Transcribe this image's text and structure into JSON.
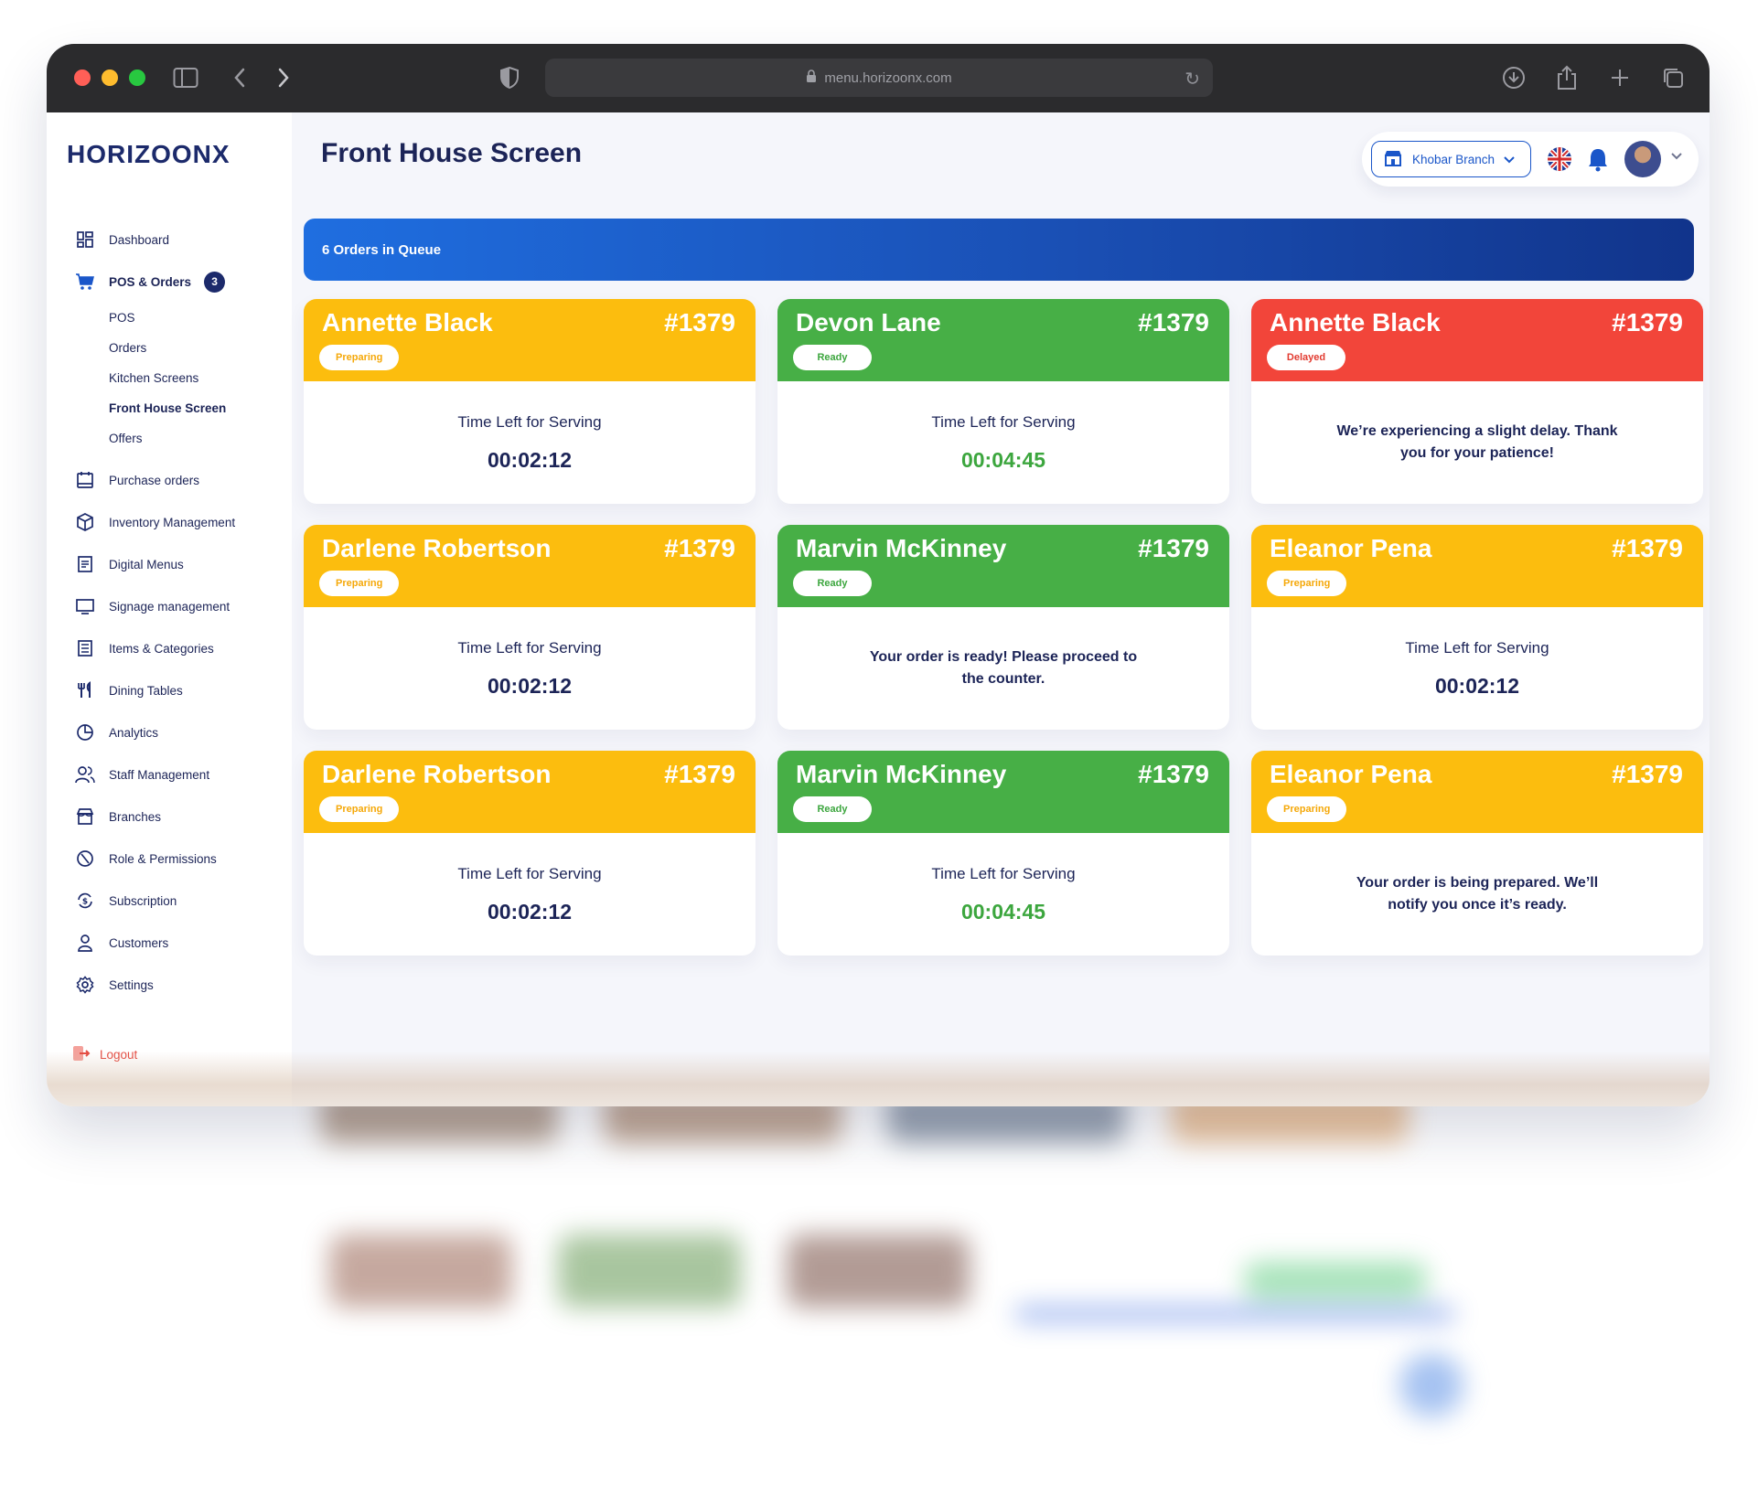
{
  "browser": {
    "url": "menu.horizoonx.com",
    "traffic_lights": [
      "#ff5f57",
      "#febc2e",
      "#28c840"
    ]
  },
  "app": {
    "logo": "HORIZOONX"
  },
  "sidebar": {
    "items": [
      {
        "id": "dashboard",
        "label": "Dashboard",
        "icon": "grid-icon"
      },
      {
        "id": "pos-orders",
        "label": "POS & Orders",
        "icon": "cart-icon",
        "badge": "3",
        "children": [
          "POS",
          "Orders",
          "Kitchen Screens",
          "Front House Screen",
          "Offers"
        ],
        "current_child": "Front House Screen"
      },
      {
        "id": "purchase-orders",
        "label": "Purchase orders",
        "icon": "clipboard-icon"
      },
      {
        "id": "inventory",
        "label": "Inventory Management",
        "icon": "box-icon"
      },
      {
        "id": "digital-menus",
        "label": "Digital Menus",
        "icon": "menu-doc-icon"
      },
      {
        "id": "signage",
        "label": "Signage management",
        "icon": "monitor-icon"
      },
      {
        "id": "items-categories",
        "label": "Items & Categories",
        "icon": "list-icon"
      },
      {
        "id": "dining-tables",
        "label": "Dining Tables",
        "icon": "fork-knife-icon"
      },
      {
        "id": "analytics",
        "label": "Analytics",
        "icon": "pie-chart-icon"
      },
      {
        "id": "staff",
        "label": "Staff Management",
        "icon": "users-icon"
      },
      {
        "id": "branches",
        "label": "Branches",
        "icon": "store-icon"
      },
      {
        "id": "roles",
        "label": "Role & Permissions",
        "icon": "shield-icon"
      },
      {
        "id": "subscription",
        "label": "Subscription",
        "icon": "refresh-coin-icon"
      },
      {
        "id": "customers",
        "label": "Customers",
        "icon": "user-icon"
      },
      {
        "id": "settings",
        "label": "Settings",
        "icon": "gear-icon"
      }
    ],
    "logout": "Logout"
  },
  "header": {
    "title": "Front House Screen",
    "branch": "Khobar Branch",
    "language_flag": "uk-flag-icon"
  },
  "queue": {
    "label": "6 Orders in Queue"
  },
  "orders": [
    {
      "name": "Annette Black",
      "number": "#1379",
      "status": "Preparing",
      "color": "#fcbd0e",
      "type": "timer",
      "label": "Time Left for Serving",
      "time": "00:02:12"
    },
    {
      "name": "Devon Lane",
      "number": "#1379",
      "status": "Ready",
      "color": "#47af46",
      "type": "timer",
      "label": "Time Left for Serving",
      "time": "00:04:45"
    },
    {
      "name": "Annette Black",
      "number": "#1379",
      "status": "Delayed",
      "color": "#f2453a",
      "type": "message",
      "message": "We’re experiencing a slight delay. Thank you for your patience!"
    },
    {
      "name": "Darlene Robertson",
      "number": "#1379",
      "status": "Preparing",
      "color": "#fcbd0e",
      "type": "timer",
      "label": "Time Left for Serving",
      "time": "00:02:12"
    },
    {
      "name": "Marvin McKinney",
      "number": "#1379",
      "status": "Ready",
      "color": "#47af46",
      "type": "message",
      "message": "Your order is ready! Please proceed to the counter."
    },
    {
      "name": "Eleanor Pena",
      "number": "#1379",
      "status": "Preparing",
      "color": "#fcbd0e",
      "type": "timer",
      "label": "Time Left for Serving",
      "time": "00:02:12"
    },
    {
      "name": "Darlene Robertson",
      "number": "#1379",
      "status": "Preparing",
      "color": "#fcbd0e",
      "type": "timer",
      "label": "Time Left for Serving",
      "time": "00:02:12"
    },
    {
      "name": "Marvin McKinney",
      "number": "#1379",
      "status": "Ready",
      "color": "#47af46",
      "type": "timer",
      "label": "Time Left for Serving",
      "time": "00:04:45"
    },
    {
      "name": "Eleanor Pena",
      "number": "#1379",
      "status": "Preparing",
      "color": "#fcbd0e",
      "type": "message",
      "message": "Your order is being prepared. We’ll notify you once it’s ready."
    }
  ]
}
